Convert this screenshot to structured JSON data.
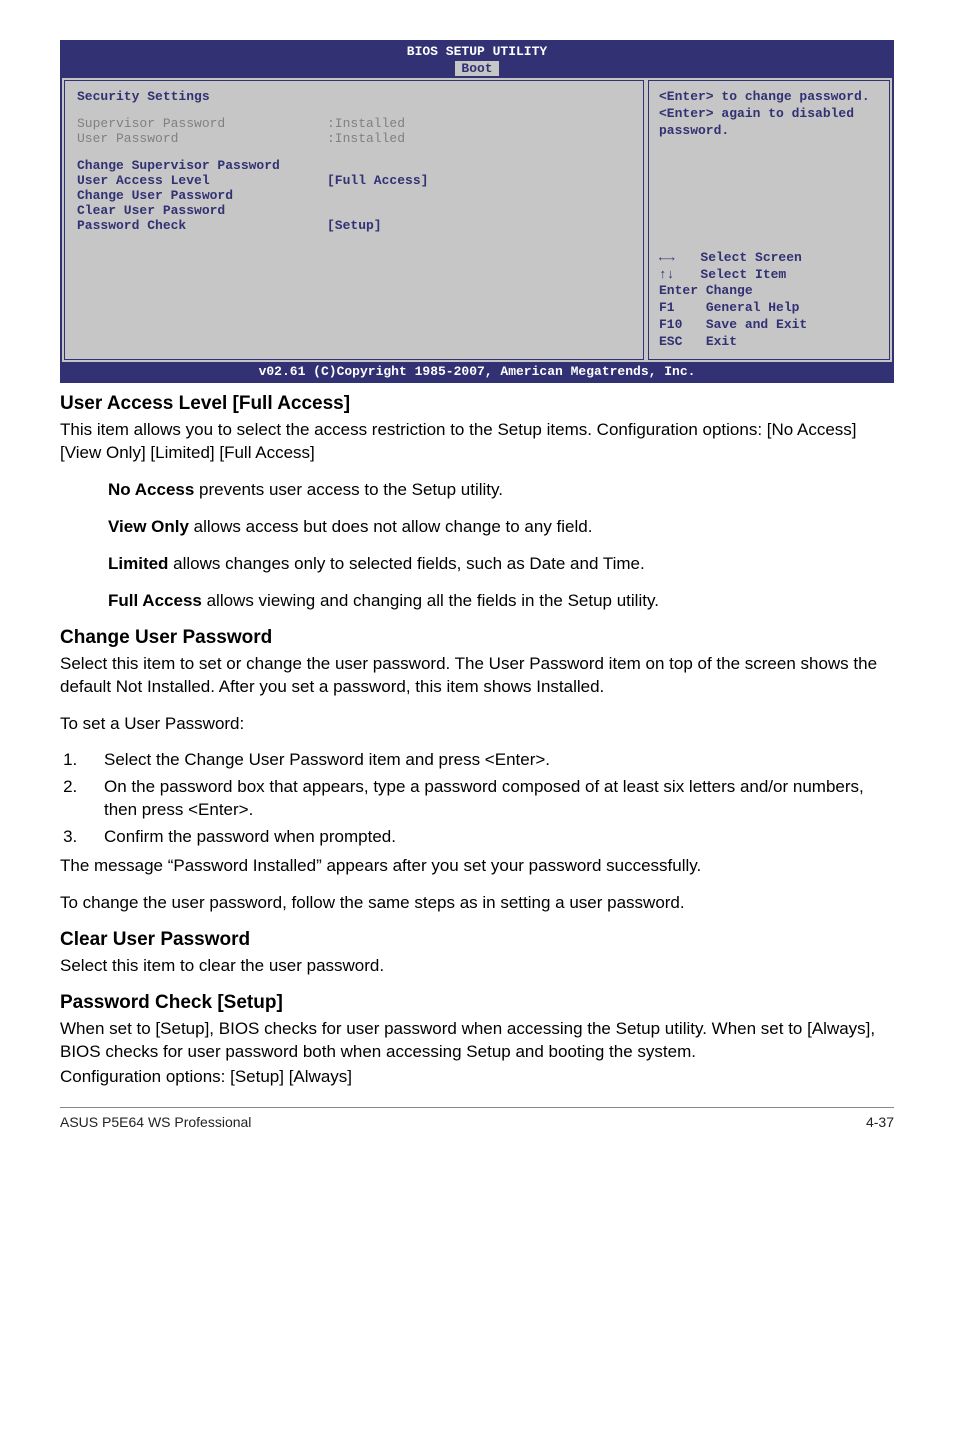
{
  "bios": {
    "title": "BIOS SETUP UTILITY",
    "tab": "Boot",
    "left": {
      "headline": "Security Settings",
      "supervisor_lbl": "Supervisor Password",
      "supervisor_val": ":Installed",
      "user_lbl": "User Password",
      "user_val": ":Installed",
      "change_sup": "Change Supervisor Password",
      "ual_lbl": "User Access Level",
      "ual_val": "[Full Access]",
      "change_user": "Change User Password",
      "clear_user": "Clear User Password",
      "pwchk_lbl": "Password Check",
      "pwchk_val": "[Setup]"
    },
    "right": {
      "help1": "<Enter> to change password.",
      "help2": "<Enter> again to disabled password.",
      "k_arrows_lr": "←→",
      "selscreen": "Select Screen",
      "k_arrows_ud": "↑↓",
      "selitem": "Select Item",
      "k_enter": "Enter",
      "change": "Change",
      "k_f1": "F1",
      "genhelp": "General Help",
      "k_f10": "F10",
      "saveexit": "Save and Exit",
      "k_esc": "ESC",
      "exit": "Exit"
    },
    "footer": "v02.61 (C)Copyright 1985-2007, American Megatrends, Inc."
  },
  "sections": {
    "ual_title": "User Access Level [Full Access]",
    "ual_body": "This item allows you to select the access restriction to the Setup items. Configuration options: [No Access] [View Only] [Limited] [Full Access]",
    "na_b": "No Access",
    "na_t": " prevents user access to the Setup utility.",
    "vo_b": "View Only",
    "vo_t": " allows access but does not allow change to any field.",
    "lim_b": "Limited",
    "lim_t": " allows changes only to selected fields, such as Date and Time.",
    "fa_b": "Full Access",
    "fa_t": " allows viewing and changing all the fields in the Setup utility.",
    "cup_title": "Change User Password",
    "cup_body": "Select this item to set or change the user password. The User Password item on top of the screen shows the default Not Installed. After you set a password, this item shows Installed.",
    "toset": "To set a User Password:",
    "step1": "Select the Change User Password item and press <Enter>.",
    "step2": "On the password box that appears, type a password composed of at least six letters and/or numbers, then press <Enter>.",
    "step3": "Confirm the password when prompted.",
    "msg_installed": "The message “Password Installed” appears after you set your password successfully.",
    "tochange": "To change the user password, follow the same steps as in setting a user password.",
    "clr_title": "Clear User Password",
    "clr_body": "Select this item to clear the user password.",
    "pc_title": "Password Check [Setup]",
    "pc_body": "When set to [Setup], BIOS checks for user password when accessing the Setup utility. When set to [Always], BIOS checks for user password both when accessing Setup and booting the system.",
    "pc_cfg": "Configuration options: [Setup] [Always]"
  },
  "footer": {
    "left": "ASUS P5E64 WS Professional",
    "right": "4-37"
  }
}
